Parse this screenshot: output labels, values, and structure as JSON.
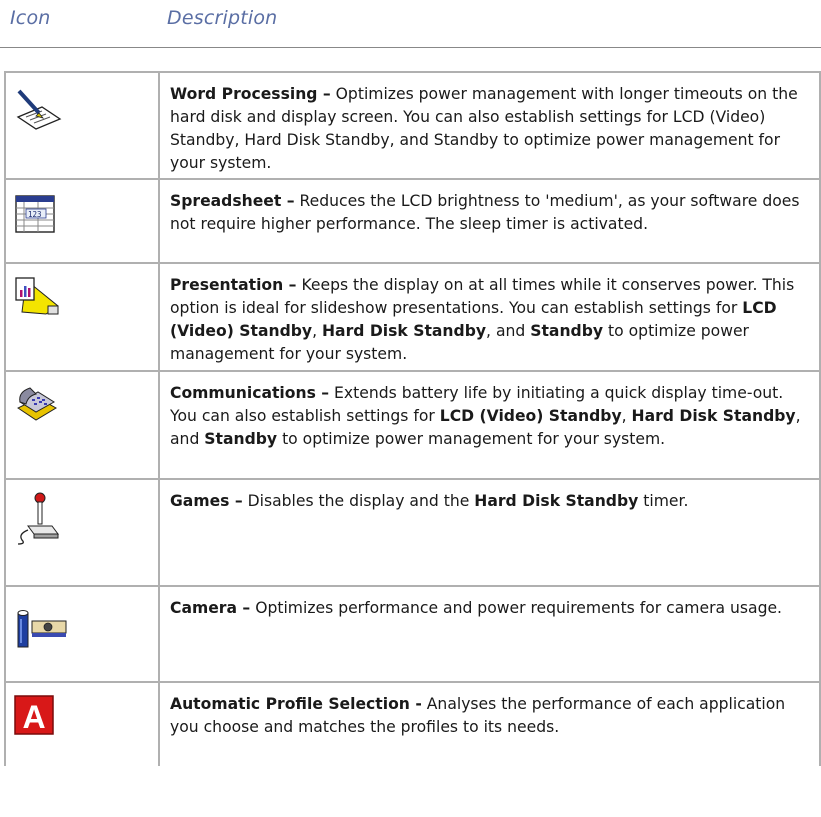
{
  "header": {
    "col_icon": "Icon",
    "col_description": "Description"
  },
  "rows": [
    {
      "icon": "word-processing-icon",
      "title": "Word Processing –",
      "text": " Optimizes power management with longer timeouts on the hard disk and display screen. You can also establish settings for LCD (Video) Standby, Hard Disk Standby, and Standby to optimize power management for your system."
    },
    {
      "icon": "spreadsheet-icon",
      "title": "Spreadsheet –",
      "text": " Reduces the LCD brightness to 'medium', as your software does not require higher performance. The sleep timer is activated."
    },
    {
      "icon": "presentation-icon",
      "title": "Presentation –",
      "t1": " Keeps the display on at all times while it conserves power. This option is ideal for slideshow presentations. You can establish settings for ",
      "b1": "LCD (Video) Standby",
      "t2": ", ",
      "b2": "Hard Disk Standby",
      "t3": ", and ",
      "b3": "Standby",
      "t4": " to optimize power management for your system."
    },
    {
      "icon": "communications-icon",
      "title": "Communications –",
      "t1": " Extends battery life by initiating a quick display time-out. You can also establish settings for ",
      "b1": "LCD (Video) Standby",
      "t2": ", ",
      "b2": "Hard Disk Standby",
      "t3": ", and ",
      "b3": "Standby",
      "t4": " to optimize power management for your system."
    },
    {
      "icon": "games-joystick-icon",
      "title": "Games –",
      "t1": " Disables the display and the ",
      "b1": "Hard Disk Standby",
      "t2": " timer."
    },
    {
      "icon": "camera-icon",
      "title": "Camera –",
      "text": " Optimizes performance and power requirements for camera usage."
    },
    {
      "icon": "automatic-profile-icon",
      "icon_letter": "A",
      "title": "Automatic Profile Selection -",
      "text": " Analyses the performance of each application you choose and matches the profiles to its needs."
    }
  ]
}
